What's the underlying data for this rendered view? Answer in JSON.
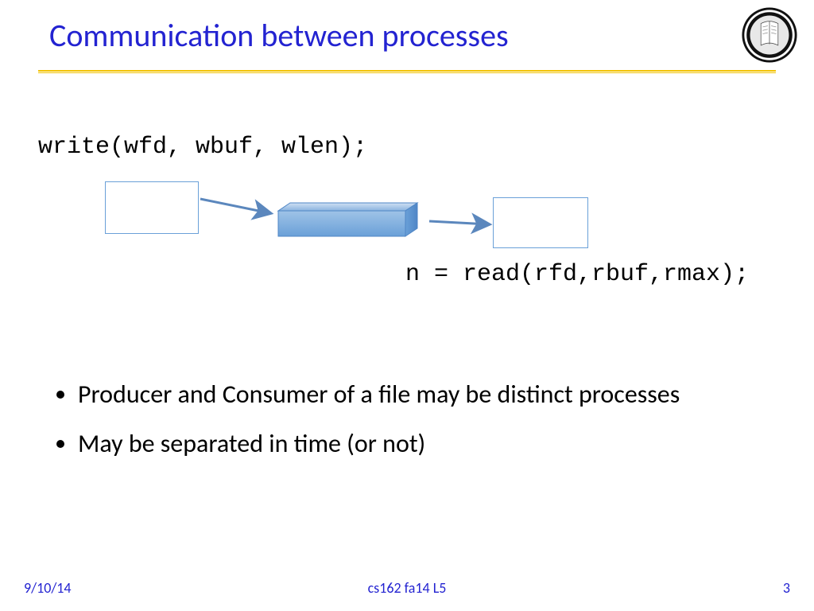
{
  "title": "Communication between processes",
  "code": {
    "write": "write(wfd, wbuf, wlen);",
    "read": "n = read(rfd,rbuf,rmax);"
  },
  "bullets": [
    "Producer and Consumer of a file may be distinct processes",
    "May be separated in time (or not)"
  ],
  "footer": {
    "date": "9/10/14",
    "label": "cs162 fa14 L5",
    "page": "3"
  },
  "icons": {
    "seal": "university-seal-icon"
  }
}
